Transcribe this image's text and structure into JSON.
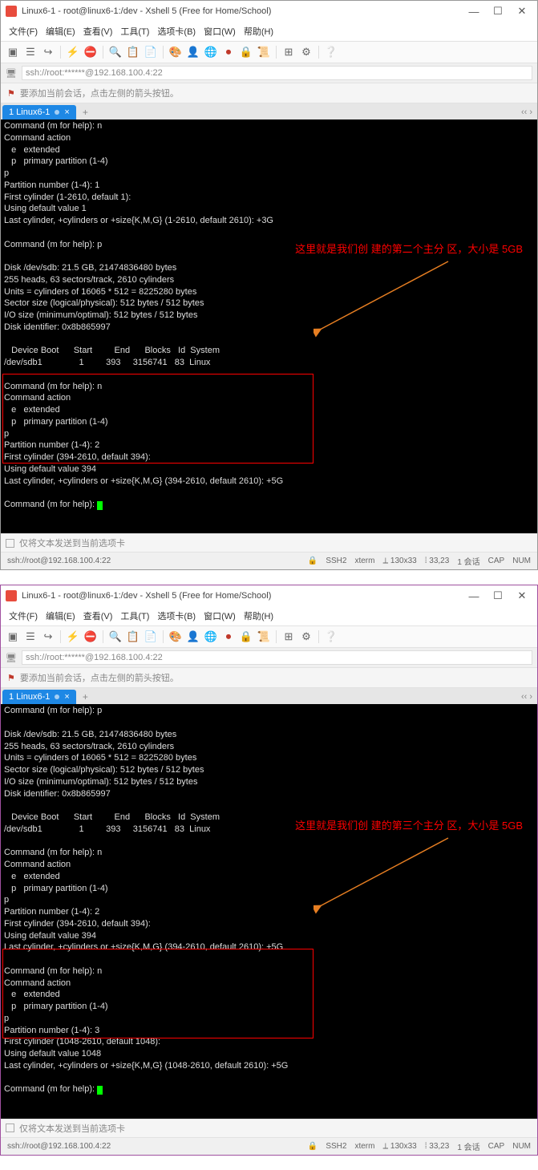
{
  "window1": {
    "title": "Linux6-1 - root@linux6-1:/dev - Xshell 5 (Free for Home/School)",
    "menubar": [
      "文件(F)",
      "编辑(E)",
      "查看(V)",
      "工具(T)",
      "选项卡(B)",
      "窗口(W)",
      "帮助(H)"
    ],
    "address": "ssh://root:******@192.168.100.4:22",
    "helptext": "要添加当前会话，点击左侧的箭头按钮。",
    "tab": "1 Linux6-1",
    "terminal": "Command (m for help): n\nCommand action\n   e   extended\n   p   primary partition (1-4)\np\nPartition number (1-4): 1\nFirst cylinder (1-2610, default 1):\nUsing default value 1\nLast cylinder, +cylinders or +size{K,M,G} (1-2610, default 2610): +3G\n\nCommand (m for help): p\n\nDisk /dev/sdb: 21.5 GB, 21474836480 bytes\n255 heads, 63 sectors/track, 2610 cylinders\nUnits = cylinders of 16065 * 512 = 8225280 bytes\nSector size (logical/physical): 512 bytes / 512 bytes\nI/O size (minimum/optimal): 512 bytes / 512 bytes\nDisk identifier: 0x8b865997\n\n   Device Boot      Start         End      Blocks   Id  System\n/dev/sdb1               1         393     3156741   83  Linux\n\nCommand (m for help): n\nCommand action\n   e   extended\n   p   primary partition (1-4)\np\nPartition number (1-4): 2\nFirst cylinder (394-2610, default 394):\nUsing default value 394\nLast cylinder, +cylinders or +size{K,M,G} (394-2610, default 2610): +5G\n\nCommand (m for help): ",
    "sendtext": "仅将文本发送到当前选项卡",
    "status": {
      "conn": "ssh://root@192.168.100.4:22",
      "proto": "SSH2",
      "term": "xterm",
      "size": "130x33",
      "cursor": "33,23",
      "sessions": "1 会话",
      "cap": "CAP",
      "num": "NUM"
    },
    "annotation": "这里就是我们创\n建的第二个主分\n区，大小是 5GB"
  },
  "window2": {
    "title": "Linux6-1 - root@linux6-1:/dev - Xshell 5 (Free for Home/School)",
    "menubar": [
      "文件(F)",
      "编辑(E)",
      "查看(V)",
      "工具(T)",
      "选项卡(B)",
      "窗口(W)",
      "帮助(H)"
    ],
    "address": "ssh://root:******@192.168.100.4:22",
    "helptext": "要添加当前会话，点击左侧的箭头按钮。",
    "tab": "1 Linux6-1",
    "terminal": "Command (m for help): p\n\nDisk /dev/sdb: 21.5 GB, 21474836480 bytes\n255 heads, 63 sectors/track, 2610 cylinders\nUnits = cylinders of 16065 * 512 = 8225280 bytes\nSector size (logical/physical): 512 bytes / 512 bytes\nI/O size (minimum/optimal): 512 bytes / 512 bytes\nDisk identifier: 0x8b865997\n\n   Device Boot      Start         End      Blocks   Id  System\n/dev/sdb1               1         393     3156741   83  Linux\n\nCommand (m for help): n\nCommand action\n   e   extended\n   p   primary partition (1-4)\np\nPartition number (1-4): 2\nFirst cylinder (394-2610, default 394):\nUsing default value 394\nLast cylinder, +cylinders or +size{K,M,G} (394-2610, default 2610): +5G\n\nCommand (m for help): n\nCommand action\n   e   extended\n   p   primary partition (1-4)\np\nPartition number (1-4): 3\nFirst cylinder (1048-2610, default 1048):\nUsing default value 1048\nLast cylinder, +cylinders or +size{K,M,G} (1048-2610, default 2610): +5G\n\nCommand (m for help): ",
    "sendtext": "仅将文本发送到当前选项卡",
    "status": {
      "conn": "ssh://root@192.168.100.4:22",
      "proto": "SSH2",
      "term": "xterm",
      "size": "130x33",
      "cursor": "33,23",
      "sessions": "1 会话",
      "cap": "CAP",
      "num": "NUM"
    },
    "annotation": "这里就是我们创\n建的第三个主分\n区，大小是 5GB"
  },
  "icons": {
    "minimize": "—",
    "maximize": "☐",
    "close": "✕",
    "lock": "🔒",
    "flag": "⚑",
    "plus": "+",
    "chev": "‹‹ ›"
  }
}
